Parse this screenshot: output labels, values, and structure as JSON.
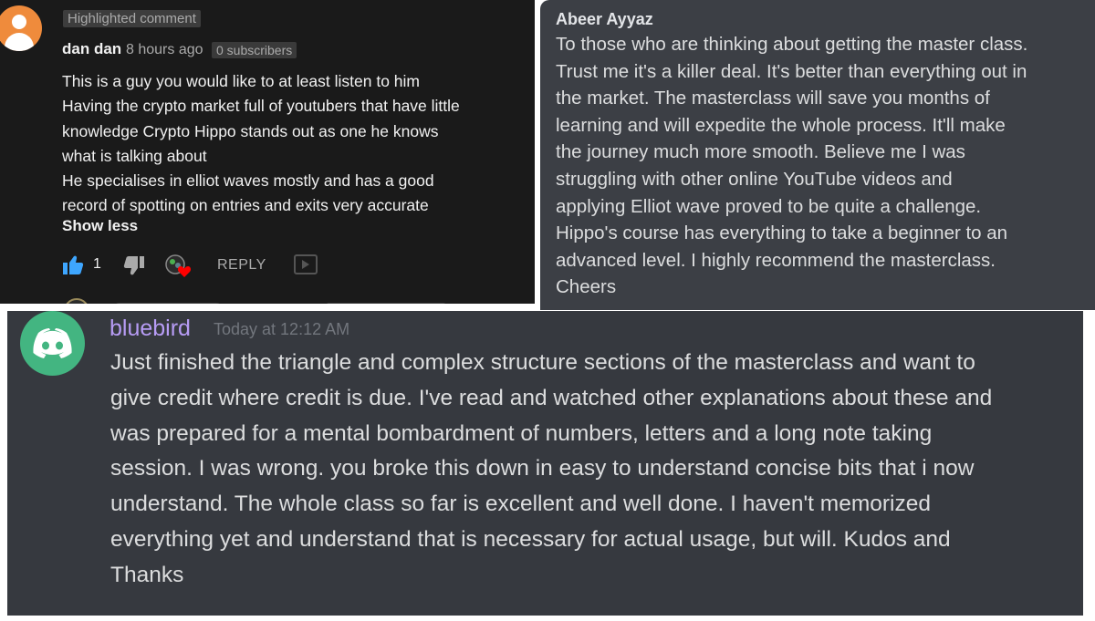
{
  "youtube_comment": {
    "badge": "Highlighted comment",
    "author": "dan dan",
    "time": "8 hours ago",
    "subscribers": "0 subscribers",
    "lines": [
      "This is a guy you would like to at least listen to him",
      "Having the crypto market full of youtubers that have little",
      "knowledge Crypto Hippo stands out as one he knows",
      "what is talking about",
      "He specialises in elliot waves mostly and has a good",
      "record of spotting on entries and exits very accurate"
    ],
    "show_less": "Show less",
    "like_count": "1",
    "reply": "REPLY",
    "colors": {
      "background": "#1a1a1a",
      "avatar": "#ef8b3c",
      "like": "#3ea6ff",
      "heart": "#ff0000"
    },
    "icons": [
      "thumbs-up-icon",
      "thumbs-down-icon",
      "creator-heart-icon",
      "reply-icon"
    ]
  },
  "comment_panel": {
    "author": "Abeer Ayyaz",
    "lines": [
      "To those who are thinking about getting the master class.",
      "Trust me it's a killer deal. It's better than everything out in",
      "the market. The masterclass will save you months of",
      "learning and will expedite the whole process. It'll make",
      "the journey much more smooth. Believe me I was",
      "struggling with other online YouTube videos and",
      "applying Elliot wave proved to be quite a challenge.",
      "Hippo's course has everything to take a beginner to an",
      "advanced level. I highly recommend the masterclass.",
      "Cheers"
    ],
    "colors": {
      "background": "#3c3f45"
    }
  },
  "discord_message": {
    "username": "bluebird",
    "timestamp": "Today at 12:12 AM",
    "lines": [
      "Just finished the triangle and complex structure sections of the masterclass and  want to",
      "give credit where credit is due. I've read and watched other explanations about these and",
      "was prepared for a mental bombardment of numbers, letters and a long note taking",
      "session. I was wrong. you broke this down in easy to understand concise bits that i now",
      "understand. The whole class so far is excellent and well done. I haven't memorized",
      "everything yet and understand that is necessary for actual usage, but will. Kudos and",
      "Thanks"
    ],
    "colors": {
      "background": "#36393f",
      "username": "#b79cf5",
      "avatar": "#43b581"
    },
    "icons": [
      "discord-logo-icon"
    ]
  }
}
